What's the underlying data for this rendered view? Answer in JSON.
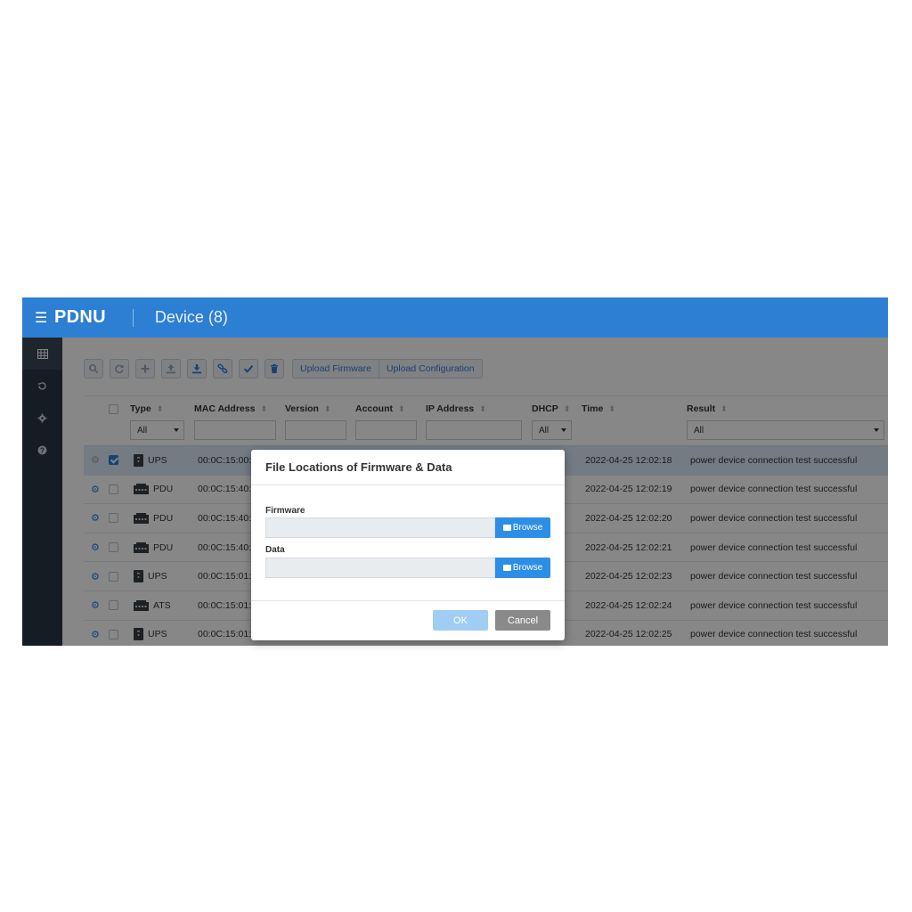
{
  "header": {
    "brand": "PDNU",
    "title": "Device (8)"
  },
  "sidebar": {
    "items": [
      "devices-icon",
      "history-icon",
      "settings-icon",
      "help-icon"
    ]
  },
  "toolbar": {
    "icons": [
      "search-icon",
      "refresh-icon",
      "add-icon",
      "upload-icon",
      "download-icon",
      "link-icon",
      "check-icon",
      "delete-icon"
    ],
    "upload_firmware": "Upload Firmware",
    "upload_configuration": "Upload Configuration"
  },
  "table": {
    "columns": {
      "type": "Type",
      "mac": "MAC Address",
      "version": "Version",
      "account": "Account",
      "ip": "IP Address",
      "dhcp": "DHCP",
      "time": "Time",
      "result": "Result"
    },
    "filters": {
      "type": "All",
      "dhcp": "All",
      "result": "All"
    },
    "rows": [
      {
        "type": "UPS",
        "mac": "00:0C:15:00:",
        "time": "2022-04-25 12:02:18",
        "result": "power device connection test successful",
        "checked": true
      },
      {
        "type": "PDU",
        "mac": "00:0C:15:40:",
        "time": "2022-04-25 12:02:19",
        "result": "power device connection test successful",
        "checked": false
      },
      {
        "type": "PDU",
        "mac": "00:0C:15:40:",
        "time": "2022-04-25 12:02:20",
        "result": "power device connection test successful",
        "checked": false
      },
      {
        "type": "PDU",
        "mac": "00:0C:15:40:",
        "time": "2022-04-25 12:02:21",
        "result": "power device connection test successful",
        "checked": false
      },
      {
        "type": "UPS",
        "mac": "00:0C:15:01:",
        "time": "2022-04-25 12:02:23",
        "result": "power device connection test successful",
        "checked": false
      },
      {
        "type": "ATS",
        "mac": "00:0C:15:01:",
        "time": "2022-04-25 12:02:24",
        "result": "power device connection test successful",
        "checked": false
      },
      {
        "type": "UPS",
        "mac": "00:0C:15:01:",
        "time": "2022-04-25 12:02:25",
        "result": "power device connection test successful",
        "checked": false
      }
    ]
  },
  "modal": {
    "title": "File Locations of Firmware & Data",
    "firmware_label": "Firmware",
    "firmware_value": "",
    "data_label": "Data",
    "data_value": "",
    "browse_label": "Browse",
    "ok_label": "OK",
    "cancel_label": "Cancel"
  },
  "colors": {
    "header": "#2d7fd3",
    "sidebar": "#2a3542",
    "accent": "#2d8ee6",
    "ok_disabled": "#9fcdf4",
    "cancel": "#8a8a8a"
  }
}
